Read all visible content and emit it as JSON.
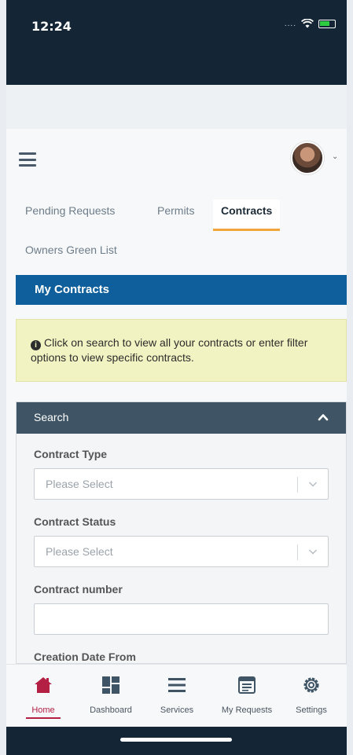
{
  "status_bar": {
    "time": "12:24",
    "signal": "....",
    "wifi_icon": "wifi-icon",
    "battery_icon": "battery-icon"
  },
  "header": {
    "menu_icon": "hamburger-menu-icon",
    "avatar": "user-avatar",
    "avatar_dropdown_icon": "chevron-down-icon"
  },
  "tabs": [
    {
      "label": "Pending Requests",
      "active": false
    },
    {
      "label": "Permits",
      "active": false
    },
    {
      "label": "Contracts",
      "active": true
    },
    {
      "label": "Owners Green List",
      "active": false
    }
  ],
  "section_title": "My Contracts",
  "info_message": "Click on search to view all your contracts or enter filter options to view specific contracts.",
  "search": {
    "title": "Search",
    "expanded": true,
    "contract_type": {
      "label": "Contract Type",
      "placeholder": "Please Select"
    },
    "contract_status": {
      "label": "Contract Status",
      "placeholder": "Please Select"
    },
    "contract_number": {
      "label": "Contract number",
      "value": ""
    },
    "creation_date_from": {
      "label": "Creation Date From"
    }
  },
  "bottom_nav": [
    {
      "label": "Home",
      "icon": "home-icon",
      "active": true
    },
    {
      "label": "Dashboard",
      "icon": "dashboard-icon",
      "active": false
    },
    {
      "label": "Services",
      "icon": "services-icon",
      "active": false
    },
    {
      "label": "My Requests",
      "icon": "my-requests-icon",
      "active": false
    },
    {
      "label": "Settings",
      "icon": "settings-icon",
      "active": false
    }
  ],
  "colors": {
    "primary": "#0e5f9b",
    "accent_tab": "#f0a63a",
    "home_active": "#b32044",
    "dark_header": "#142536",
    "search_header": "#3f5565",
    "info_bg": "#f2f3c2"
  }
}
